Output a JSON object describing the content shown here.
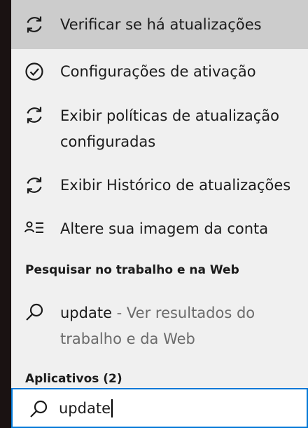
{
  "results": [
    {
      "label": "Verificar se há atualizações",
      "icon": "sync-icon"
    },
    {
      "label": "Configurações de ativação",
      "icon": "check-circle-icon"
    },
    {
      "label": "Exibir políticas de atualização configuradas",
      "icon": "sync-icon"
    },
    {
      "label": "Exibir Histórico de atualizações",
      "icon": "sync-icon"
    },
    {
      "label": "Altere sua imagem da conta",
      "icon": "account-list-icon"
    }
  ],
  "web_section": {
    "header": "Pesquisar no trabalho e na Web",
    "query": "update",
    "suffix": " - Ver resultados do trabalho e da Web"
  },
  "apps_section": {
    "header": "Aplicativos (2)"
  },
  "search": {
    "value": "update"
  },
  "colors": {
    "accent": "#0078d7",
    "selected": "#cccccc",
    "panel": "#f0f0f0"
  }
}
